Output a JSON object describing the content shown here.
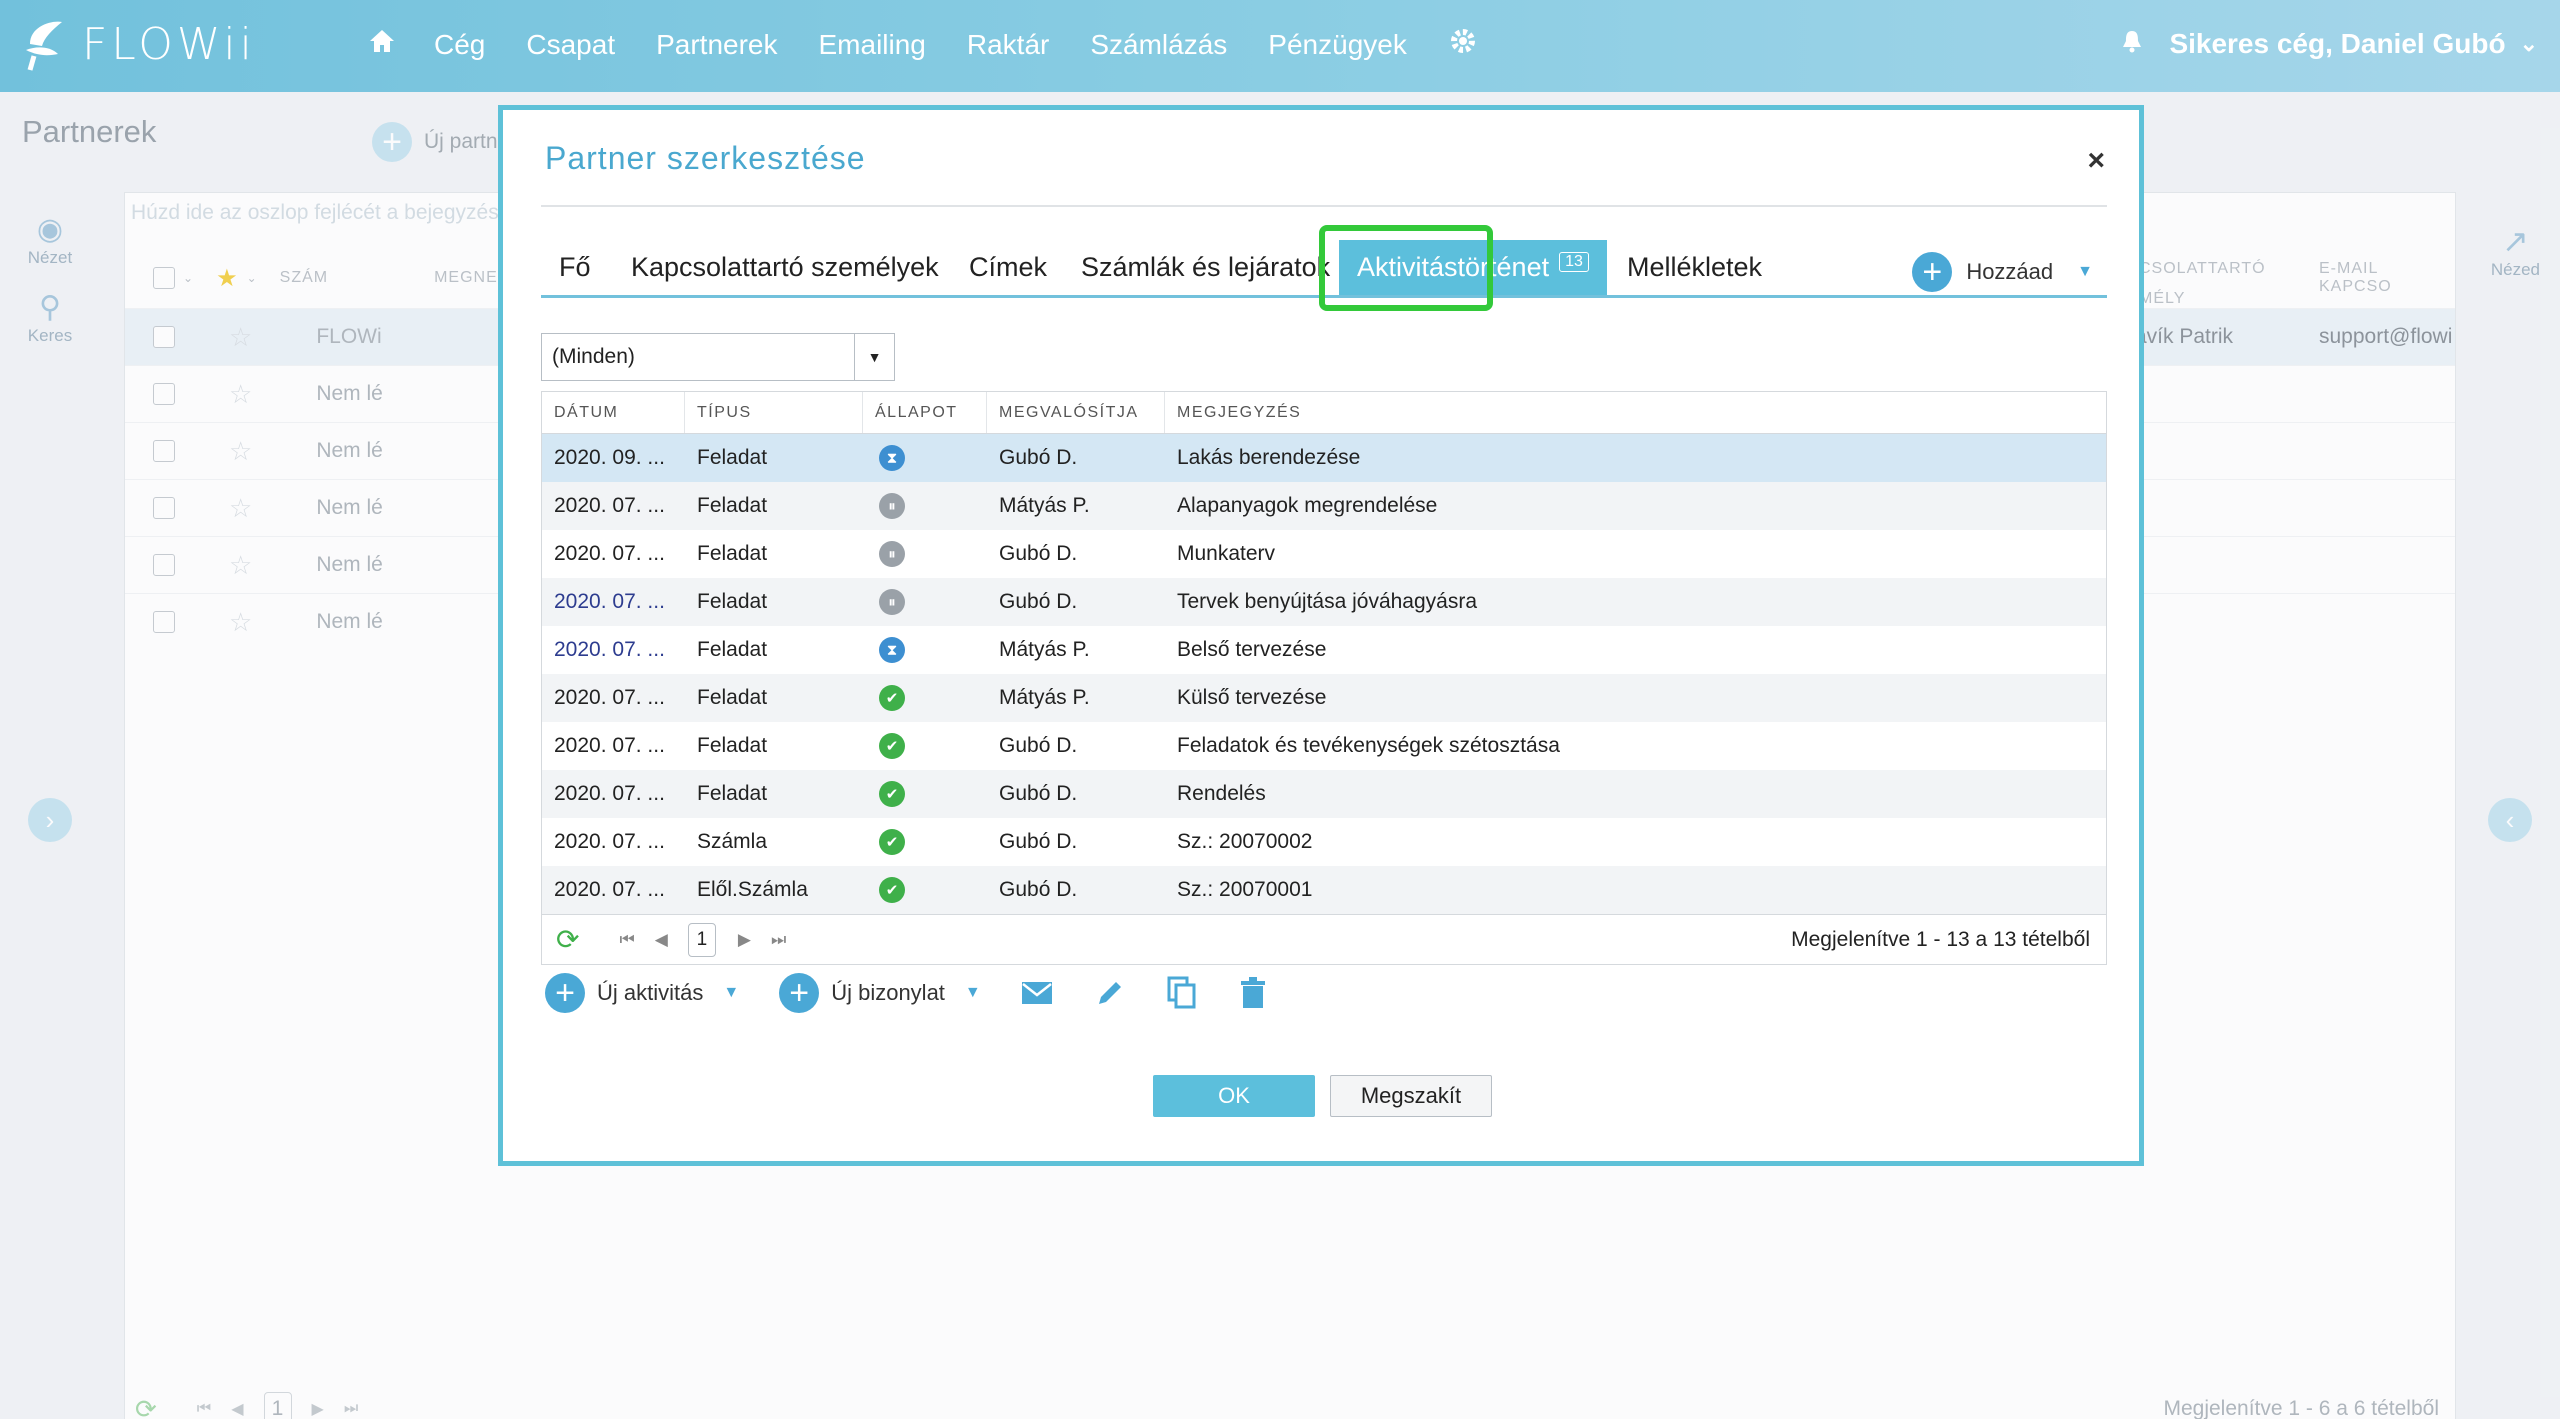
{
  "app": {
    "logo_text": "FLOWii"
  },
  "nav": {
    "items": [
      "Cég",
      "Csapat",
      "Partnerek",
      "Emailing",
      "Raktár",
      "Számlázás",
      "Pénzügyek"
    ],
    "user": "Sikeres cég, Daniel Gubó"
  },
  "page": {
    "title": "Partnerek",
    "new_partner_label": "Új partn",
    "grid_hint": "Húzd ide az oszlop fejlécét a bejegyzés",
    "left_nav": [
      {
        "label": "Nézet",
        "icon": "eye-icon"
      },
      {
        "label": "Keres",
        "icon": "search-icon"
      }
    ],
    "right_nav": {
      "label": "Nézed",
      "icon": "external-link-icon"
    },
    "headers": {
      "szam": "SZÁM",
      "megne": "MEGNE",
      "kapcs": "CSOLATTARTÓ",
      "kapcs2": "MÉLY",
      "email": "E-MAIL KAPCSO"
    },
    "rows": [
      "FLOWi",
      "Nem lé",
      "Nem lé",
      "Nem lé",
      "Nem lé",
      "Nem lé"
    ],
    "first_row_contact": "avík Patrik",
    "first_row_email": "support@flowi",
    "footer_page": "1",
    "footer_info": "Megjelenítve 1 - 6 a 6 tételből"
  },
  "modal": {
    "title": "Partner szerkesztése",
    "close": "×",
    "tabs": [
      "Fő",
      "Kapcsolattartó személyek",
      "Címek",
      "Számlák és lejáratok",
      "Aktivitástörténet",
      "Mellékletek"
    ],
    "active_tab_badge": "13",
    "add_label": "Hozzáad",
    "filter_value": "(Minden)",
    "columns": [
      "DÁTUM",
      "TÍPUS",
      "ÁLLAPOT",
      "MEGVALÓSÍTJA",
      "MEGJEGYZÉS"
    ],
    "rows": [
      {
        "date": "2020. 09. ...",
        "type": "Feladat",
        "status": "in-progress",
        "owner": "Gubó D.",
        "note": "Lakás berendezése"
      },
      {
        "date": "2020. 07. ...",
        "type": "Feladat",
        "status": "paused",
        "owner": "Mátyás P.",
        "note": "Alapanyagok megrendelése"
      },
      {
        "date": "2020. 07. ...",
        "type": "Feladat",
        "status": "paused",
        "owner": "Gubó D.",
        "note": "Munkaterv"
      },
      {
        "date": "2020. 07. ...",
        "type": "Feladat",
        "status": "paused",
        "owner": "Gubó D.",
        "note": "Tervek benyújtása jóváhagyásra"
      },
      {
        "date": "2020. 07. ...",
        "type": "Feladat",
        "status": "in-progress",
        "owner": "Mátyás P.",
        "note": "Belső tervezése"
      },
      {
        "date": "2020. 07. ...",
        "type": "Feladat",
        "status": "done",
        "owner": "Mátyás P.",
        "note": "Külső tervezése"
      },
      {
        "date": "2020. 07. ...",
        "type": "Feladat",
        "status": "done",
        "owner": "Gubó D.",
        "note": "Feladatok és tevékenységek szétosztása"
      },
      {
        "date": "2020. 07. ...",
        "type": "Feladat",
        "status": "done",
        "owner": "Gubó D.",
        "note": "Rendelés"
      },
      {
        "date": "2020. 07. ...",
        "type": "Számla",
        "status": "done",
        "owner": "Gubó D.",
        "note": "Sz.: 20070002"
      },
      {
        "date": "2020. 07. ...",
        "type": "Elől.Számla",
        "status": "done",
        "owner": "Gubó D.",
        "note": "Sz.: 20070001"
      }
    ],
    "page": "1",
    "footer_info": "Megjelenítve 1 - 13 a 13 tételből",
    "new_activity": "Új aktivitás",
    "new_document": "Új bizonylat",
    "ok": "OK",
    "cancel": "Megszakít"
  },
  "colors": {
    "accent": "#5cbfdc",
    "highlight": "#33c93a",
    "done": "#3fb04a",
    "progress": "#3d8fd1",
    "paused": "#9aa1a8"
  }
}
